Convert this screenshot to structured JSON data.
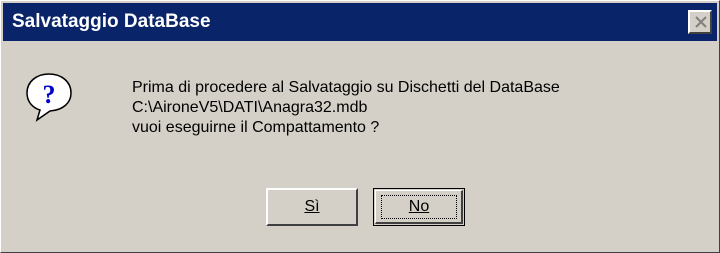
{
  "window": {
    "title": "Salvataggio DataBase",
    "close_icon": "close-icon"
  },
  "message": {
    "icon": "question-icon",
    "lines": [
      "Prima di procedere al Salvataggio su Dischetti del DataBase",
      "C:\\AironeV5\\DATI\\Anagra32.mdb",
      "vuoi eseguirne il Compattamento ?"
    ]
  },
  "buttons": {
    "yes_label": "Sì",
    "no_label": "No"
  },
  "colors": {
    "titlebar": "#0a246a",
    "face": "#d4d0c8"
  }
}
